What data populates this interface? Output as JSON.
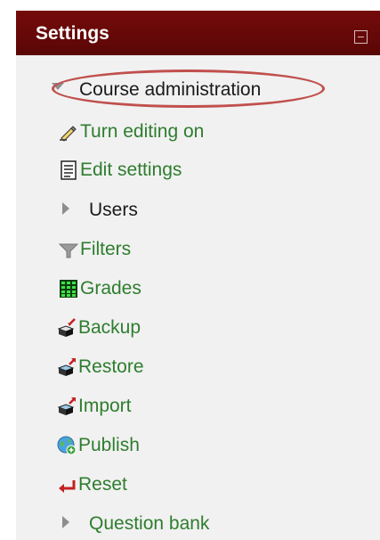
{
  "block": {
    "title": "Settings",
    "root_label": "Course administration",
    "items": [
      {
        "label": "Turn editing on",
        "icon": "pencil-icon"
      },
      {
        "label": "Edit settings",
        "icon": "document-icon"
      },
      {
        "label": "Users",
        "icon": "expand-arrow-icon",
        "expandable": true
      },
      {
        "label": "Filters",
        "icon": "funnel-icon"
      },
      {
        "label": "Grades",
        "icon": "grid-icon"
      },
      {
        "label": "Backup",
        "icon": "backup-icon"
      },
      {
        "label": "Restore",
        "icon": "restore-icon"
      },
      {
        "label": "Import",
        "icon": "import-icon"
      },
      {
        "label": "Publish",
        "icon": "globe-icon"
      },
      {
        "label": "Reset",
        "icon": "reset-arrow-icon"
      },
      {
        "label": "Question bank",
        "icon": "expand-arrow-icon",
        "expandable": true
      }
    ]
  },
  "colors": {
    "header_bg": "#6b0808",
    "link": "#2e7d2e",
    "highlight": "#c0504d",
    "panel_bg": "#f1f1f1"
  }
}
